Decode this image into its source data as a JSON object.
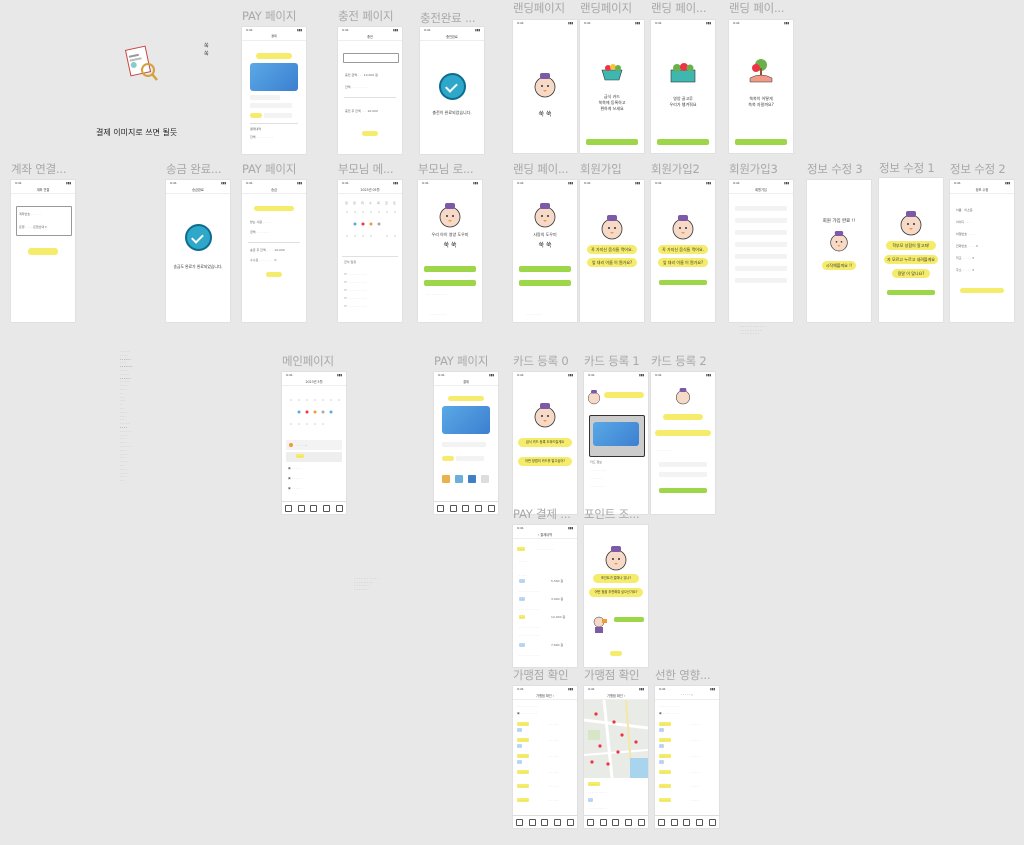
{
  "frames": {
    "pay1": "PAY 페이지",
    "charge": "충전 페이지",
    "charge_done": "충전완료 ...",
    "landing1": "랜딩페이지",
    "landing2": "랜딩페이지",
    "landing3": "랜딩 페이...",
    "landing4": "랜딩 페이...",
    "account": "계좌 연결...",
    "send_done": "송금 완료...",
    "pay2": "PAY 페이지",
    "parent_main": "부모님 메...",
    "parent_login": "부모님 로...",
    "landing5": "랜딩 페이...",
    "signup": "회원가입",
    "signup2": "회원가입2",
    "signup3": "회원가입3",
    "info3": "정보 수정 3",
    "info1": "정보 수정 1",
    "info2": "정보 수정 2",
    "main": "메인페이지",
    "pay3": "PAY 페이지",
    "card0": "카드 등록 0",
    "card1": "카드 등록 1",
    "card2": "카드 등록 2",
    "pay_pay": "PAY 결제 ...",
    "point": "포인트 조...",
    "store1": "가맹점 확인",
    "store2": "가맹점 확인",
    "good": "선한 영향..."
  },
  "notes": {
    "payment_image": "결제 이미지로 쓰면 될듯",
    "ssuk_small": "쑥\n쑥"
  },
  "screens": {
    "charge_done_msg": "충전이 완료되었습니다.",
    "send_done_msg": "송금도 완료가 완료되었습니다.",
    "ssuk": "쑥 쑥",
    "landing2_msg": "급식 카드\n쑥쑥에 등록하고\n편하게 쓰세요",
    "landing3_msg": "영양 골고루\n우리가 챙겨줘요",
    "landing4_msg": "쑥쑥이 어떻게\n쑥쑥 자랄까요?",
    "parent_login_msg": "우리 아이 영양 도우미",
    "landing5_msg": "사랑의 도우미",
    "signup_q1": "꼭 가지신 음식들 먹어요.",
    "signup_q2": "앞 대리 이름 이 뭔가요?",
    "signup_done": "회원 가입 완료 !!",
    "signup_start": "시작해볼까요 !!",
    "info_q1": "학부모 성함이 알고파!",
    "info_q2": "자 모르고 누르고 내려볼게요",
    "info_q3": "정말 이 맞나요?",
    "card0_q1": "급식 카드 등록 도와드릴게요",
    "card0_q2": "어떤 방법의 카드를 알고싶어?",
    "point_q1": "포인트가 얼마나 있나?",
    "point_q2": "어떤 점을 추천해줘 싶으신가요?"
  },
  "colors": {
    "accent_yellow": "#f4ec6a",
    "accent_green": "#9ed64a",
    "check_blue": "#2ea7c9",
    "bg": "#e8e8e8"
  }
}
